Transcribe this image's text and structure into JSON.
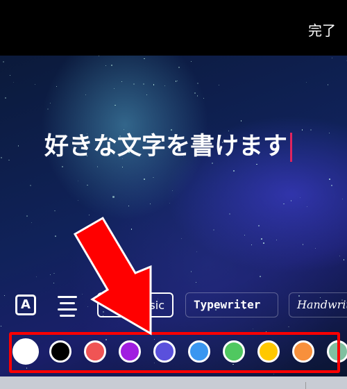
{
  "header": {
    "done_label": "完了"
  },
  "editor": {
    "text": "好きな文字を書けます",
    "caret_color": "#e0245e"
  },
  "toolbar": {
    "text_style_icon": "A",
    "fonts": [
      {
        "label": "Classic",
        "visible": "sic"
      },
      {
        "label": "Typewriter"
      },
      {
        "label": "Handwriting",
        "visible": "Handwrit"
      }
    ]
  },
  "colors": [
    "#ffffff",
    "#000000",
    "#f05454",
    "#a01ee0",
    "#5a50dc",
    "#3a96f0",
    "#50c860",
    "#ffc800",
    "#f8903c",
    "#80c0a0"
  ],
  "annotation": {
    "arrow_color": "#ff0000",
    "box_color": "#ff0000"
  }
}
